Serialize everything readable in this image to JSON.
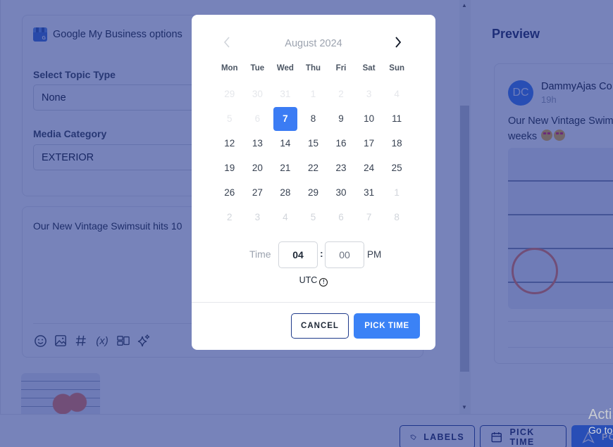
{
  "editor": {
    "gmb_title": "Google My Business options",
    "topic_label": "Select Topic Type",
    "topic_value": "None",
    "media_label": "Media Category",
    "media_value": "EXTERIOR",
    "post_text": "Our New Vintage Swimsuit hits 10",
    "toolbar": [
      {
        "icon": "emoji-icon",
        "glyph": "☺"
      },
      {
        "icon": "image-icon",
        "glyph": "🖾"
      },
      {
        "icon": "hashtag-icon",
        "glyph": "#"
      },
      {
        "icon": "variable-icon",
        "glyph": "(x)"
      },
      {
        "icon": "layout-icon",
        "glyph": "▭"
      },
      {
        "icon": "ai-sparkle-icon",
        "glyph": "✧"
      }
    ]
  },
  "preview": {
    "title": "Preview",
    "avatar_initials": "DC",
    "account_name": "DammyAjas Co",
    "time_ago": "19h",
    "text_line1": "Our New Vintage Swim",
    "text_line2": "weeks"
  },
  "bottom_bar": {
    "labels_button": "LABELS",
    "pick_time_button": "PICK TIME",
    "post_button": "PO"
  },
  "watermark": {
    "line1": "Acti",
    "line2": "Go to"
  },
  "datepicker": {
    "month_label": "August 2024",
    "weekdays": [
      "Mon",
      "Tue",
      "Wed",
      "Thu",
      "Fri",
      "Sat",
      "Sun"
    ],
    "weeks": [
      [
        {
          "d": "29",
          "s": "outside"
        },
        {
          "d": "30",
          "s": "outside"
        },
        {
          "d": "31",
          "s": "outside"
        },
        {
          "d": "1",
          "s": "disabled"
        },
        {
          "d": "2",
          "s": "disabled"
        },
        {
          "d": "3",
          "s": "disabled"
        },
        {
          "d": "4",
          "s": "disabled"
        }
      ],
      [
        {
          "d": "5",
          "s": "disabled"
        },
        {
          "d": "6",
          "s": "disabled"
        },
        {
          "d": "7",
          "s": "selected"
        },
        {
          "d": "8",
          "s": "normal"
        },
        {
          "d": "9",
          "s": "normal"
        },
        {
          "d": "10",
          "s": "normal"
        },
        {
          "d": "11",
          "s": "normal"
        }
      ],
      [
        {
          "d": "12",
          "s": "normal"
        },
        {
          "d": "13",
          "s": "normal"
        },
        {
          "d": "14",
          "s": "normal"
        },
        {
          "d": "15",
          "s": "normal"
        },
        {
          "d": "16",
          "s": "normal"
        },
        {
          "d": "17",
          "s": "normal"
        },
        {
          "d": "18",
          "s": "normal"
        }
      ],
      [
        {
          "d": "19",
          "s": "normal"
        },
        {
          "d": "20",
          "s": "normal"
        },
        {
          "d": "21",
          "s": "normal"
        },
        {
          "d": "22",
          "s": "normal"
        },
        {
          "d": "23",
          "s": "normal"
        },
        {
          "d": "24",
          "s": "normal"
        },
        {
          "d": "25",
          "s": "normal"
        }
      ],
      [
        {
          "d": "26",
          "s": "normal"
        },
        {
          "d": "27",
          "s": "normal"
        },
        {
          "d": "28",
          "s": "normal"
        },
        {
          "d": "29",
          "s": "normal"
        },
        {
          "d": "30",
          "s": "normal"
        },
        {
          "d": "31",
          "s": "normal"
        },
        {
          "d": "1",
          "s": "next"
        }
      ],
      [
        {
          "d": "2",
          "s": "next"
        },
        {
          "d": "3",
          "s": "next"
        },
        {
          "d": "4",
          "s": "next"
        },
        {
          "d": "5",
          "s": "next"
        },
        {
          "d": "6",
          "s": "next"
        },
        {
          "d": "7",
          "s": "next"
        },
        {
          "d": "8",
          "s": "next"
        }
      ]
    ],
    "time_label": "Time",
    "hour": "04",
    "minute": "00",
    "separator": ":",
    "ampm": "PM",
    "timezone": "UTC",
    "cancel_label": "CANCEL",
    "confirm_label": "PICK TIME",
    "accent_color": "#3b82f6"
  }
}
